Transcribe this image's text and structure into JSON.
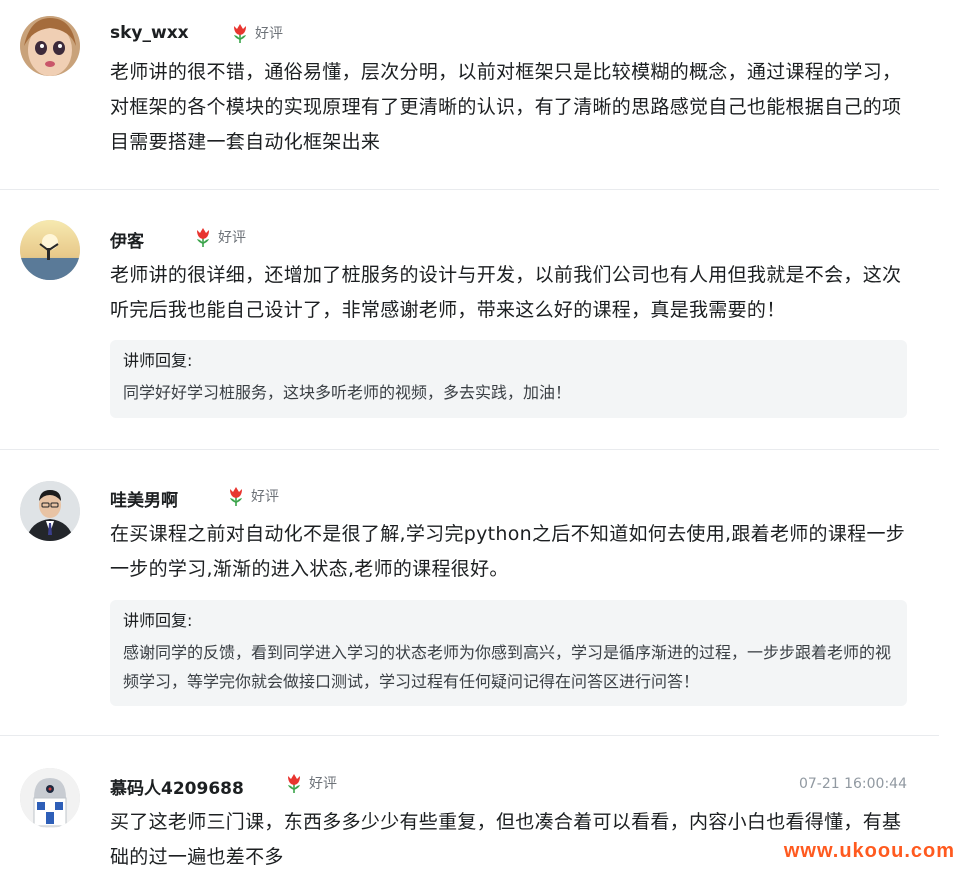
{
  "reviews": [
    {
      "username": "sky_wxx",
      "rating_icon": "flower-icon",
      "rating_label": "好评",
      "content": "老师讲的很不错，通俗易懂，层次分明，以前对框架只是比较模糊的概念，通过课程的学习，对框架的各个模块的实现原理有了更清晰的认识，有了清晰的思路感觉自己也能根据自己的项目需要搭建一套自动化框架出来",
      "avatar_icon": "doll-face-avatar"
    },
    {
      "username": "伊客",
      "rating_icon": "flower-icon",
      "rating_label": "好评",
      "content": "老师讲的很详细，还增加了桩服务的设计与开发，以前我们公司也有人用但我就是不会，这次听完后我也能自己设计了，非常感谢老师，带来这么好的课程，真是我需要的！",
      "reply_title": "讲师回复:",
      "reply_text": "同学好好学习桩服务，这块多听老师的视频，多去实践，加油！",
      "avatar_icon": "sunset-landscape-avatar"
    },
    {
      "username": "哇美男啊",
      "rating_icon": "flower-icon",
      "rating_label": "好评",
      "content": "在买课程之前对自动化不是很了解,学习完python之后不知道如何去使用,跟着老师的课程一步一步的学习,渐渐的进入状态,老师的课程很好。",
      "reply_title": "讲师回复:",
      "reply_text": "感谢同学的反馈，看到同学进入学习的状态老师为你感到高兴，学习是循序渐进的过程，一步步跟着老师的视频学习，等学完你就会做接口测试，学习过程有任何疑问记得在问答区进行问答！",
      "avatar_icon": "man-in-suit-avatar"
    },
    {
      "username": "慕码人4209688",
      "rating_icon": "flower-icon",
      "rating_label": "好评",
      "time": "07-21 16:00:44",
      "content": "买了这老师三门课，东西多多少少有些重复，但也凑合着可以看看，内容小白也看得懂，有基础的过一遍也差不多",
      "avatar_icon": "robot-avatar"
    }
  ],
  "watermark": "www.ukoou.com",
  "colors": {
    "flower_red": "#e8352f",
    "watermark_orange": "#ff5a1f",
    "reply_bg": "#f3f5f6"
  }
}
